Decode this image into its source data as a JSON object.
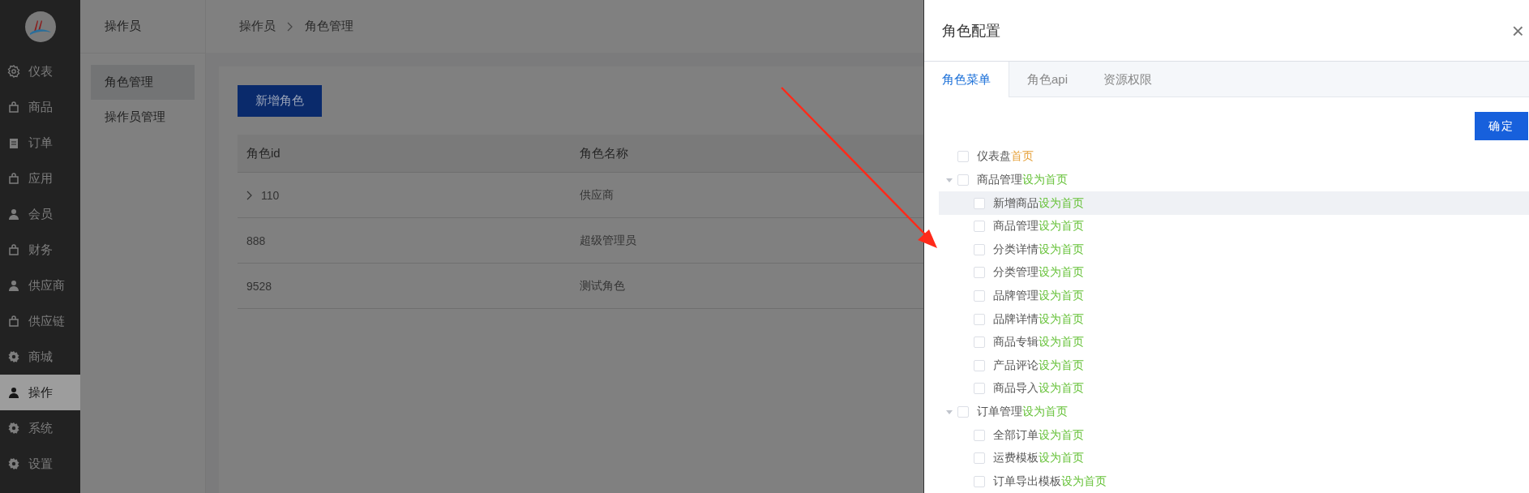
{
  "sidebar": {
    "items": [
      {
        "label": "仪表",
        "selected": false
      },
      {
        "label": "商品",
        "selected": false
      },
      {
        "label": "订单",
        "selected": false
      },
      {
        "label": "应用",
        "selected": false
      },
      {
        "label": "会员",
        "selected": false
      },
      {
        "label": "财务",
        "selected": false
      },
      {
        "label": "供应商",
        "selected": false
      },
      {
        "label": "供应链",
        "selected": false
      },
      {
        "label": "商城",
        "selected": false
      },
      {
        "label": "操作",
        "selected": true
      },
      {
        "label": "系统",
        "selected": false
      },
      {
        "label": "设置",
        "selected": false
      }
    ]
  },
  "submenu": {
    "title": "操作员",
    "items": [
      {
        "label": "角色管理",
        "selected": true
      },
      {
        "label": "操作员管理",
        "selected": false
      }
    ]
  },
  "breadcrumb": [
    "操作员",
    "角色管理"
  ],
  "add_button": "新增角色",
  "table": {
    "columns": [
      "角色id",
      "角色名称"
    ],
    "rows": [
      {
        "cells": [
          "110",
          "供应商"
        ],
        "expandable": true
      },
      {
        "cells": [
          "888",
          "超级管理员"
        ],
        "expandable": false
      },
      {
        "cells": [
          "9528",
          "测试角色"
        ],
        "expandable": false
      }
    ]
  },
  "drawer": {
    "title": "角色配置",
    "close": "×",
    "tabs": [
      {
        "label": "角色菜单",
        "selected": true
      },
      {
        "label": "角色api",
        "selected": false
      },
      {
        "label": "资源权限",
        "selected": false
      }
    ],
    "confirm_button": "确定",
    "tree": [
      {
        "label": "仪表盘",
        "home": "首页",
        "color": "#e6a23c",
        "checked": false,
        "highlighted": false
      },
      {
        "label": "商品管理",
        "home": "设为首页",
        "color": "#67c23a",
        "checked": false,
        "highlighted": false,
        "expanded": true,
        "children": [
          {
            "label": "新增商品",
            "home": "设为首页",
            "color": "#67c23a",
            "checked": false,
            "highlighted": true
          },
          {
            "label": "商品管理",
            "home": "设为首页",
            "color": "#67c23a",
            "checked": false,
            "highlighted": false
          },
          {
            "label": "分类详情",
            "home": "设为首页",
            "color": "#67c23a",
            "checked": false,
            "highlighted": false
          },
          {
            "label": "分类管理",
            "home": "设为首页",
            "color": "#67c23a",
            "checked": false,
            "highlighted": false
          },
          {
            "label": "品牌管理",
            "home": "设为首页",
            "color": "#67c23a",
            "checked": false,
            "highlighted": false
          },
          {
            "label": "品牌详情",
            "home": "设为首页",
            "color": "#67c23a",
            "checked": false,
            "highlighted": false
          },
          {
            "label": "商品专辑",
            "home": "设为首页",
            "color": "#67c23a",
            "checked": false,
            "highlighted": false
          },
          {
            "label": "产品评论",
            "home": "设为首页",
            "color": "#67c23a",
            "checked": false,
            "highlighted": false
          },
          {
            "label": "商品导入",
            "home": "设为首页",
            "color": "#67c23a",
            "checked": false,
            "highlighted": false
          }
        ]
      },
      {
        "label": "订单管理",
        "home": "设为首页",
        "color": "#67c23a",
        "checked": false,
        "highlighted": false,
        "expanded": true,
        "children": [
          {
            "label": "全部订单",
            "home": "设为首页",
            "color": "#67c23a",
            "checked": false,
            "highlighted": false
          },
          {
            "label": "运费模板",
            "home": "设为首页",
            "color": "#67c23a",
            "checked": false,
            "highlighted": false
          },
          {
            "label": "订单导出模板",
            "home": "设为首页",
            "color": "#67c23a",
            "checked": false,
            "highlighted": false
          }
        ]
      }
    ]
  }
}
